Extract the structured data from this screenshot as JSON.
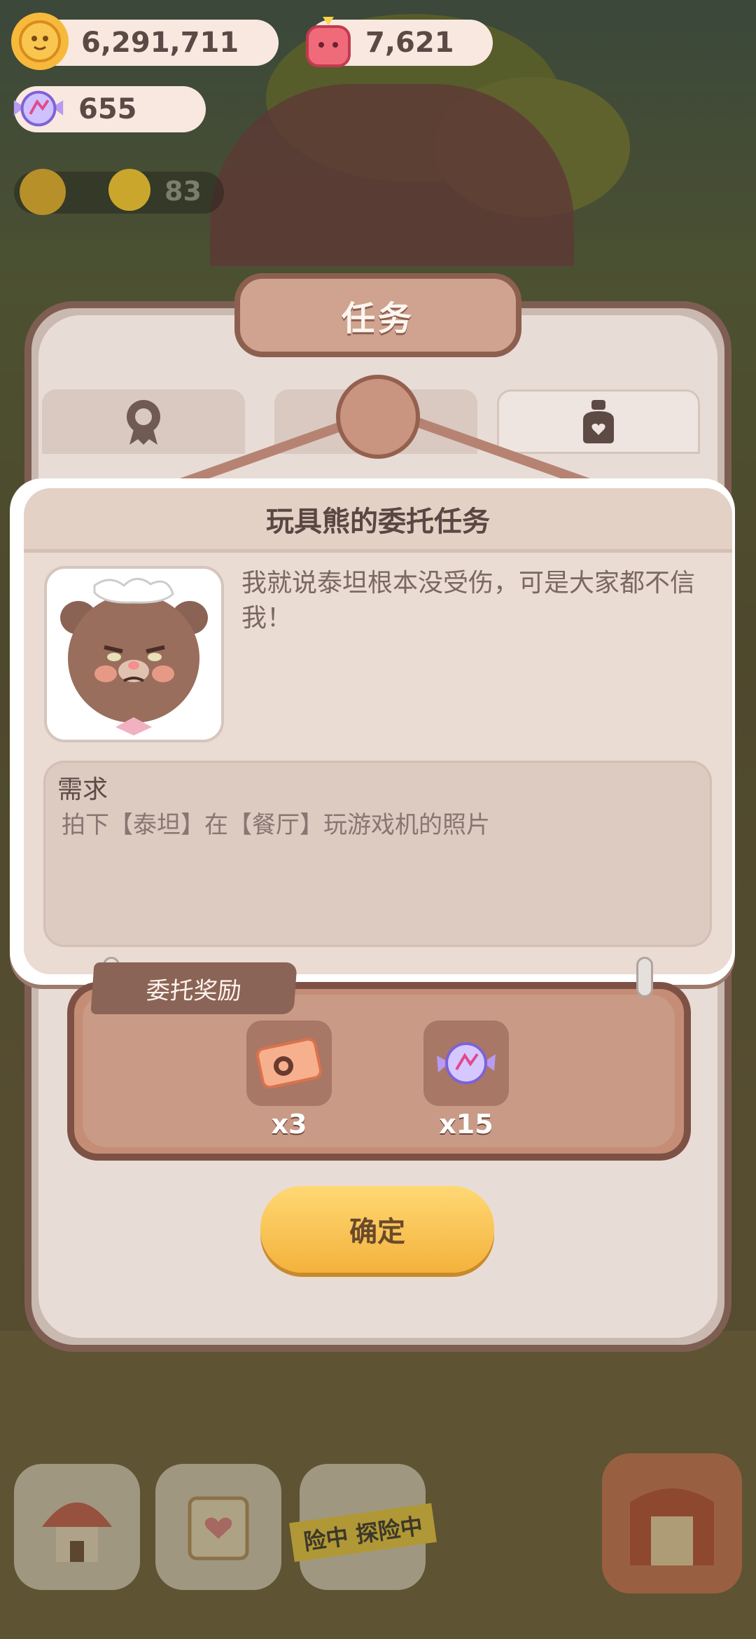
{
  "currencies": {
    "coins": "6,291,711",
    "gems": "7,621",
    "candy": "655",
    "energy": "83"
  },
  "window": {
    "title": "任务"
  },
  "dialog": {
    "title": "玩具熊的委托任务",
    "quote": "我就说泰坦根本没受伤，可是大家都不信我！",
    "requirement_label": "需求",
    "requirement_text": "拍下【泰坦】在【餐厅】玩游戏机的照片"
  },
  "reward": {
    "label": "委托奖励",
    "items": [
      {
        "icon": "ticket-icon",
        "qty": "x3"
      },
      {
        "icon": "candy-icon",
        "qty": "x15"
      }
    ]
  },
  "buttons": {
    "confirm": "确定"
  },
  "bottom_banner": "险中 探险中",
  "colors": {
    "accent_button": "#f4b23c",
    "frame_brown": "#7e5e52"
  }
}
